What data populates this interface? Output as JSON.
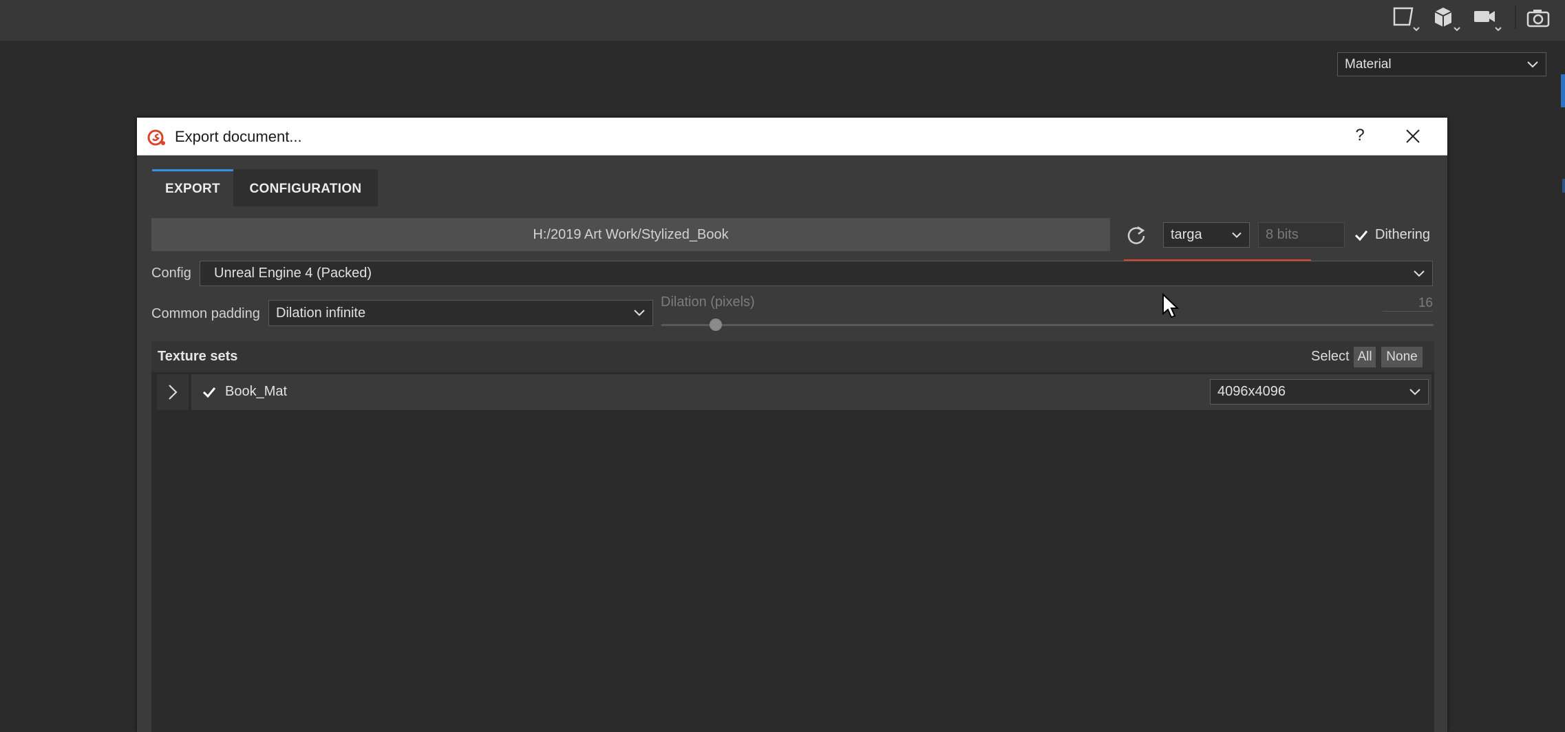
{
  "toolbar": {
    "icons": [
      "viewport-2d-icon",
      "cube-icon",
      "camera-icon",
      "screenshot-icon"
    ]
  },
  "viewport": {
    "channel_select": "Material"
  },
  "dialog": {
    "title": "Export document...",
    "help": "?",
    "tabs": [
      {
        "label": "EXPORT",
        "active": true
      },
      {
        "label": "CONFIGURATION",
        "active": false
      }
    ],
    "output_path": "H:/2019 Art Work/Stylized_Book",
    "format": "targa",
    "bit_depth": "8 bits",
    "dithering": {
      "label": "Dithering",
      "checked": true
    },
    "config": {
      "label": "Config",
      "value": "Unreal Engine 4 (Packed)"
    },
    "padding": {
      "label": "Common padding",
      "value": "Dilation infinite"
    },
    "dilation": {
      "label": "Dilation (pixels)",
      "value": "16"
    },
    "texture_sets": {
      "title": "Texture sets",
      "select_label": "Select",
      "all_button": "All",
      "none_button": "None",
      "items": [
        {
          "name": "Book_Mat",
          "checked": true,
          "resolution": "4096x4096"
        }
      ]
    }
  },
  "colors": {
    "accent": "#3a8ee6",
    "highlight": "#e8402b",
    "background": "#2b2b2b"
  }
}
